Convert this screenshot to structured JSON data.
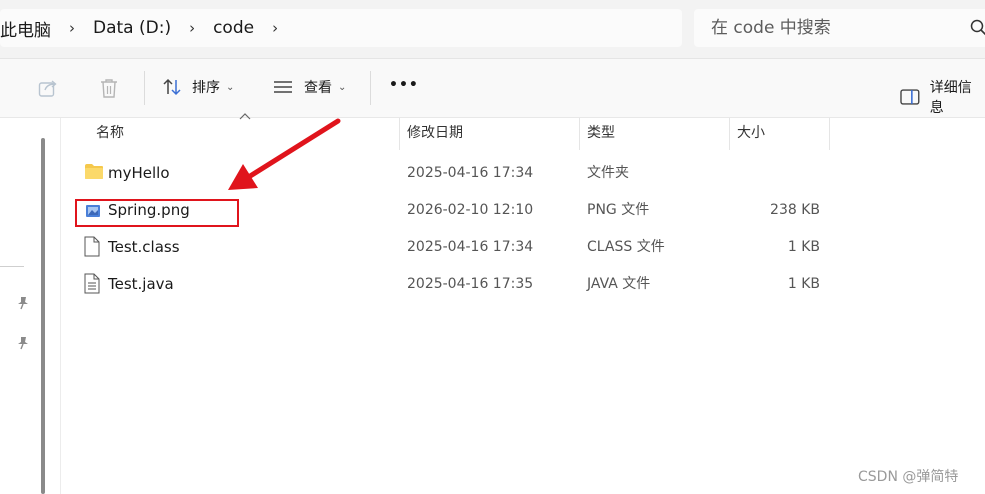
{
  "breadcrumb": {
    "items": [
      "此电脑",
      "Data (D:)",
      "code"
    ],
    "separator": "›"
  },
  "search": {
    "placeholder": "在 code 中搜索"
  },
  "toolbar": {
    "sort_label": "排序",
    "view_label": "查看",
    "more_label": "•••",
    "details_label": "详细信息"
  },
  "columns": {
    "name": "名称",
    "date": "修改日期",
    "type": "类型",
    "size": "大小"
  },
  "files": [
    {
      "icon": "folder-icon",
      "name": "myHello",
      "date": "2025-04-16 17:34",
      "type": "文件夹",
      "size": ""
    },
    {
      "icon": "image-file-icon",
      "name": "Spring.png",
      "date": "2026-02-10 12:10",
      "type": "PNG 文件",
      "size": "238 KB"
    },
    {
      "icon": "file-icon",
      "name": "Test.class",
      "date": "2025-04-16 17:34",
      "type": "CLASS 文件",
      "size": "1 KB"
    },
    {
      "icon": "file-icon",
      "name": "Test.java",
      "date": "2025-04-16 17:35",
      "type": "JAVA 文件",
      "size": "1 KB"
    }
  ],
  "annotation": {
    "color": "#e0141c"
  },
  "watermark": "CSDN @弹简特",
  "colors": {
    "addressbar_bg": "#f3f3f3",
    "toolbar_bg": "#f9f9f9",
    "folder": "#f5c84c",
    "image_icon": "#4a7fd8"
  }
}
